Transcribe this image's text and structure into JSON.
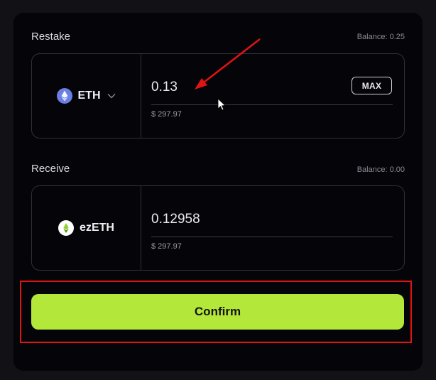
{
  "restake": {
    "label": "Restake",
    "balance": "Balance: 0.25",
    "token": {
      "symbol": "ETH",
      "icon": "eth-icon"
    },
    "amount": "0.13",
    "usd_value": "$ 297.97",
    "max_label": "MAX"
  },
  "receive": {
    "label": "Receive",
    "balance": "Balance: 0.00",
    "token": {
      "symbol": "ezETH",
      "icon": "ezeth-icon"
    },
    "amount": "0.12958",
    "usd_value": "$ 297.97"
  },
  "confirm_label": "Confirm",
  "annotations": {
    "highlight_color": "#e01414",
    "arrow_color": "#e01414"
  },
  "colors": {
    "accent": "#b3e83a",
    "panel_bg": "#050509",
    "page_bg": "#111116",
    "eth_icon": "#6b7fe3"
  }
}
